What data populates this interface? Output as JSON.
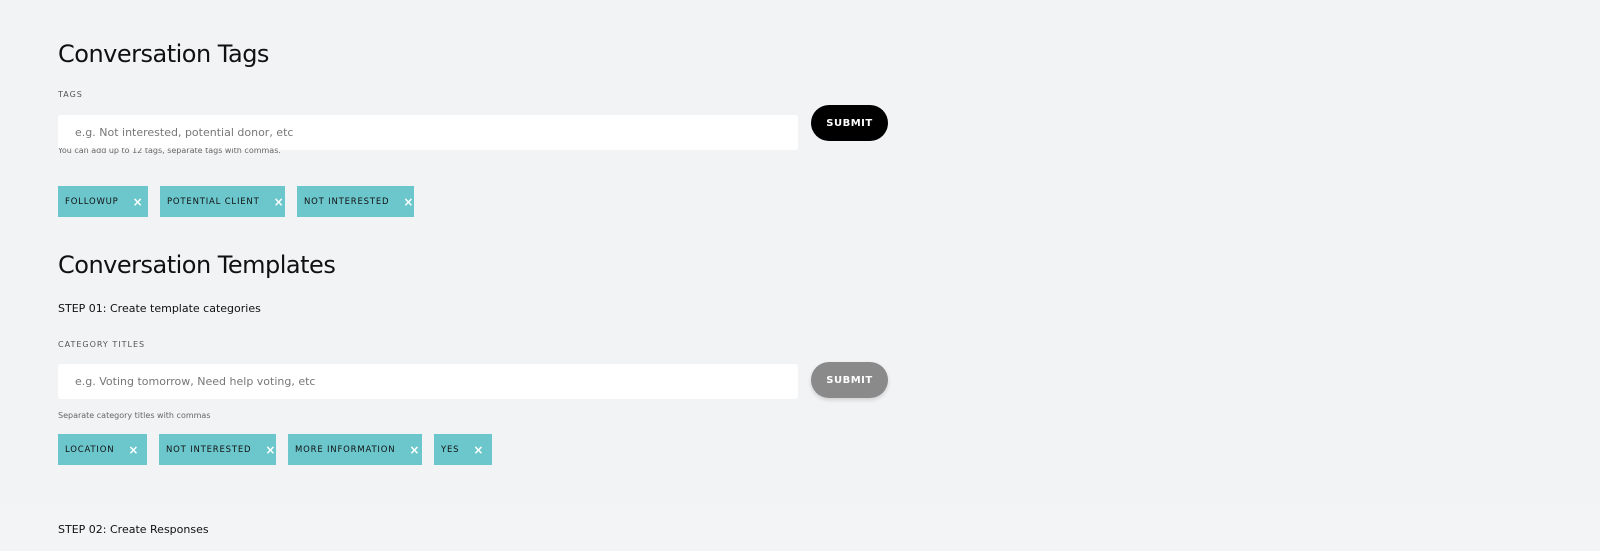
{
  "tags_section": {
    "title": "Conversation Tags",
    "label": "TAGS",
    "input_placeholder": "e.g. Not interested, potential donor, etc",
    "submit_label": "SUBMIT",
    "helper": "You can add up to 12 tags, separate tags with commas.",
    "chips": [
      {
        "label": "FOLLOWUP",
        "remove": "×"
      },
      {
        "label": "POTENTIAL CLIENT",
        "remove": "×"
      },
      {
        "label": "NOT INTERESTED",
        "remove": "×"
      }
    ]
  },
  "templates_section": {
    "title": "Conversation Templates",
    "step1": "STEP 01: Create template categories",
    "label": "CATEGORY TITLES",
    "input_placeholder": "e.g. Voting tomorrow, Need help voting, etc",
    "submit_label": "SUBMIT",
    "helper": "Separate category titles with commas",
    "chips": [
      {
        "label": "LOCATION",
        "remove": "×"
      },
      {
        "label": "NOT INTERESTED",
        "remove": "×"
      },
      {
        "label": "MORE INFORMATION",
        "remove": "×"
      },
      {
        "label": "YES",
        "remove": "×"
      }
    ],
    "step2": "STEP 02: Create Responses"
  },
  "colors": {
    "background": "#f2f3f5",
    "chip": "#6cc7cd",
    "button_active": "#000000",
    "button_disabled": "#8a8a8a"
  }
}
